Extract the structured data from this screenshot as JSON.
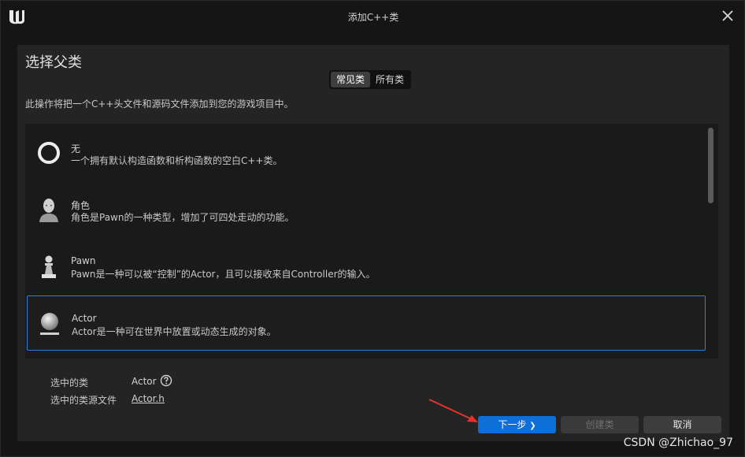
{
  "window": {
    "title": "添加C++类"
  },
  "header": {
    "heading": "选择父类",
    "description": "此操作将把一个C++头文件和源码文件添加到您的游戏项目中。"
  },
  "tabs": [
    {
      "label": "常见类",
      "active": true
    },
    {
      "label": "所有类",
      "active": false
    }
  ],
  "classes": [
    {
      "name": "无",
      "description": "一个拥有默认构造函数和析构函数的空白C++类。",
      "icon": "ring-icon"
    },
    {
      "name": "角色",
      "description": "角色是Pawn的一种类型，增加了可四处走动的功能。",
      "icon": "character-head-icon"
    },
    {
      "name": "Pawn",
      "description": "Pawn是一种可以被“控制”的Actor，且可以接收来自Controller的输入。",
      "icon": "pawn-icon"
    },
    {
      "name": "Actor",
      "description": "Actor是一种可在世界中放置或动态生成的对象。",
      "icon": "sphere-icon",
      "selected": true
    }
  ],
  "selection": {
    "class_label": "选中的类",
    "class_value": "Actor",
    "source_label": "选中的类源文件",
    "source_value": "Actor.h"
  },
  "buttons": {
    "next": "下一步",
    "next_glyph": "❯",
    "create": "创建类",
    "cancel": "取消"
  },
  "watermark": "CSDN @Zhichao_97",
  "colors": {
    "accent": "#0f6fd8",
    "selection_border": "#2f7ed8",
    "annotation_arrow": "#e8302a"
  }
}
